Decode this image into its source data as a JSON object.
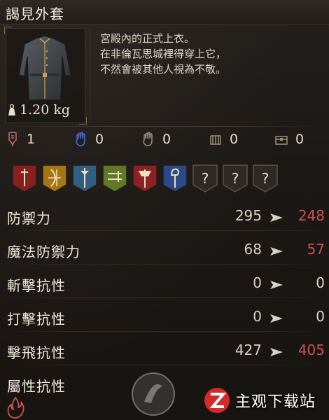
{
  "item": {
    "name": "謁見外套",
    "weight": "1.20 kg",
    "description": [
      "宮殿內的正式上衣。",
      "在非倫瓦思城裡得穿上它，",
      "不然會被其他人視為不敬。"
    ]
  },
  "requirements": [
    {
      "icon": "strength-icon",
      "value": "1",
      "color": "#c2686a"
    },
    {
      "icon": "dexterity-icon",
      "value": "0",
      "color": "#4a6fd0"
    },
    {
      "icon": "vitality-icon",
      "value": "0",
      "color": "#a08f7a"
    },
    {
      "icon": "endurance-icon",
      "value": "0",
      "color": "#a08f7a"
    },
    {
      "icon": "chest-icon",
      "value": "0",
      "color": "#a08f7a"
    }
  ],
  "vocations": [
    {
      "name": "fighter-icon",
      "bg": "#8a1f1f"
    },
    {
      "name": "strider-icon",
      "bg": "#a67514"
    },
    {
      "name": "mage-icon",
      "bg": "#2f5f83"
    },
    {
      "name": "warrior-icon",
      "bg": "#5e7a24"
    },
    {
      "name": "axe-icon",
      "bg": "#8c2224"
    },
    {
      "name": "sorcerer-icon",
      "bg": "#2c4a8a"
    },
    {
      "name": "unknown-icon",
      "bg": "#2c2926"
    },
    {
      "name": "unknown-icon",
      "bg": "#2c2926"
    },
    {
      "name": "unknown-icon",
      "bg": "#2c2926"
    }
  ],
  "vocation_unknown_label": "?",
  "stats": [
    {
      "label": "防禦力",
      "old": "295",
      "new": "248",
      "trend": "down"
    },
    {
      "label": "魔法防禦力",
      "old": "68",
      "new": "57",
      "trend": "down"
    },
    {
      "label": "斬擊抗性",
      "old": "0",
      "new": "0",
      "trend": "same"
    },
    {
      "label": "打擊抗性",
      "old": "0",
      "new": "0",
      "trend": "same"
    },
    {
      "label": "擊飛抗性",
      "old": "427",
      "new": "405",
      "trend": "down"
    },
    {
      "label": "屬性抗性",
      "old": "",
      "new": "",
      "trend": "same"
    }
  ],
  "watermark": {
    "text": "主观下载站",
    "url": "www.zgndw888.com"
  },
  "colors": {
    "down": "#c9534c",
    "same": "#ddd5c6",
    "accent": "#7a6a4e"
  }
}
